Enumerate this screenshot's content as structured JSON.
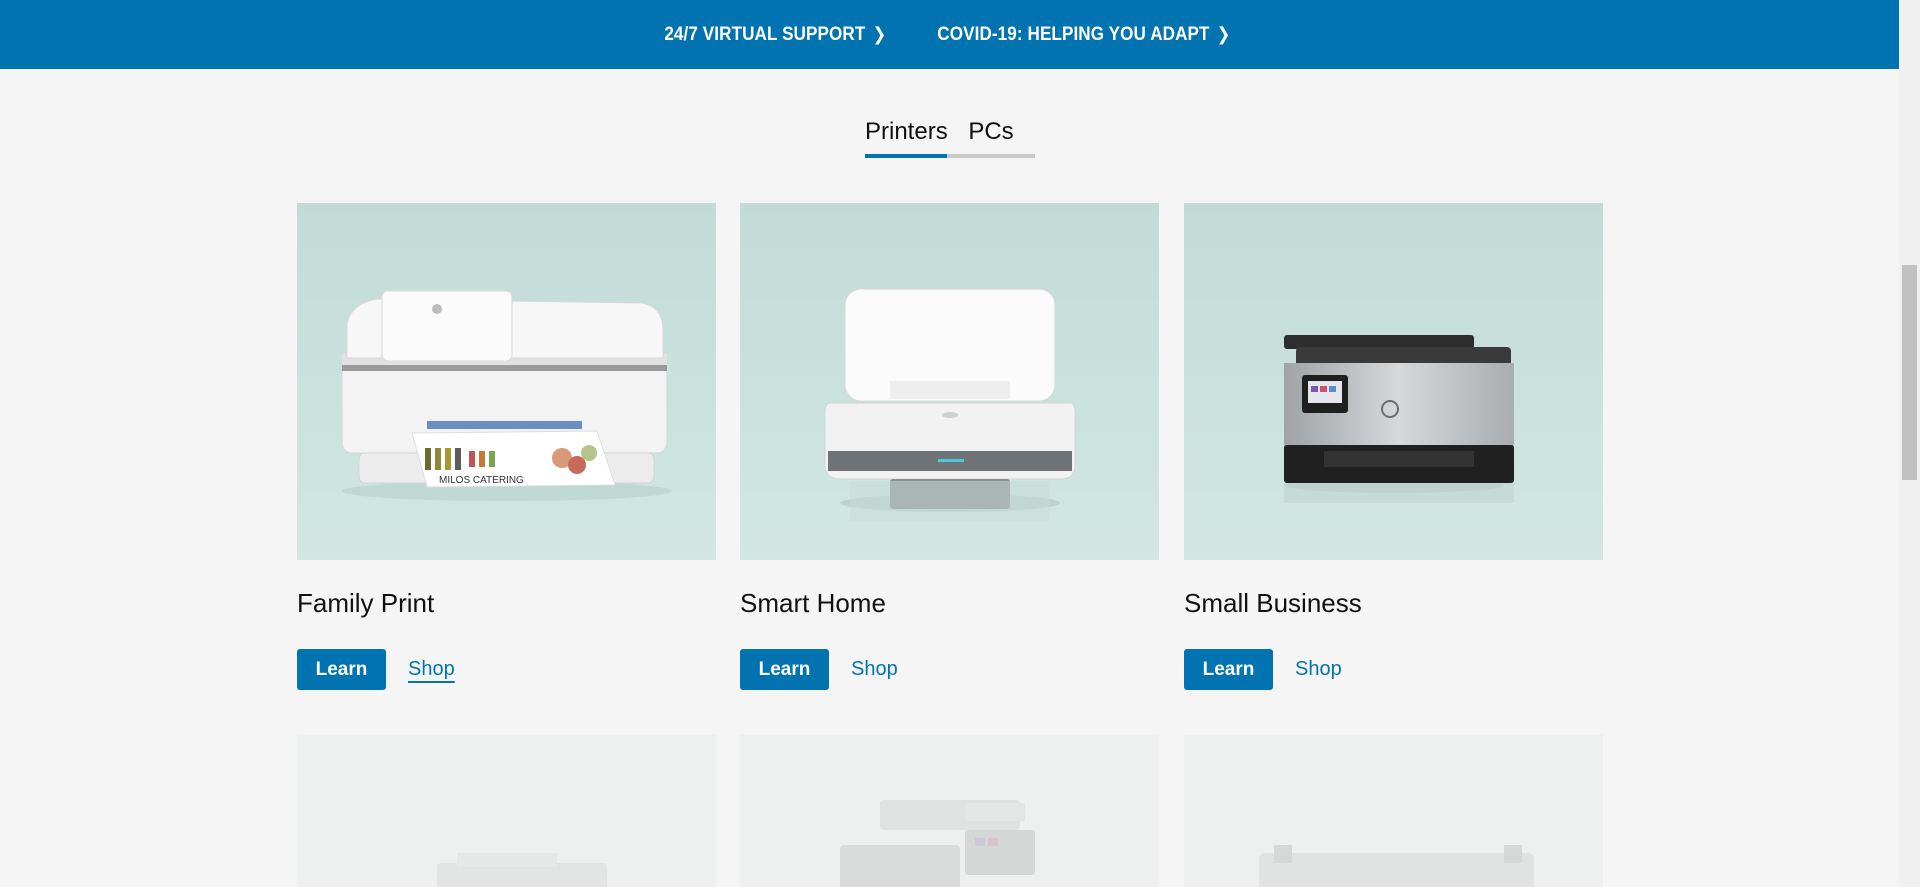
{
  "banner": {
    "links": [
      {
        "label": "24/7 VIRTUAL SUPPORT",
        "chevron": "❯"
      },
      {
        "label": "COVID-19: HELPING YOU ADAPT",
        "chevron": "❯"
      }
    ],
    "background": "#0073b0"
  },
  "tabs": [
    {
      "label": "Printers",
      "active": true
    },
    {
      "label": "PCs",
      "active": false
    }
  ],
  "cards": [
    {
      "title": "Family Print",
      "learn_label": "Learn",
      "shop_label": "Shop",
      "image_icon": "inkjet-printer-icon"
    },
    {
      "title": "Smart Home",
      "learn_label": "Learn",
      "shop_label": "Shop",
      "image_icon": "compact-printer-icon"
    },
    {
      "title": "Small Business",
      "learn_label": "Learn",
      "shop_label": "Shop",
      "image_icon": "office-printer-icon"
    }
  ],
  "colors": {
    "accent": "#0073b0",
    "card_bg": "#c8e0da",
    "page_bg": "#f5f5f5"
  }
}
